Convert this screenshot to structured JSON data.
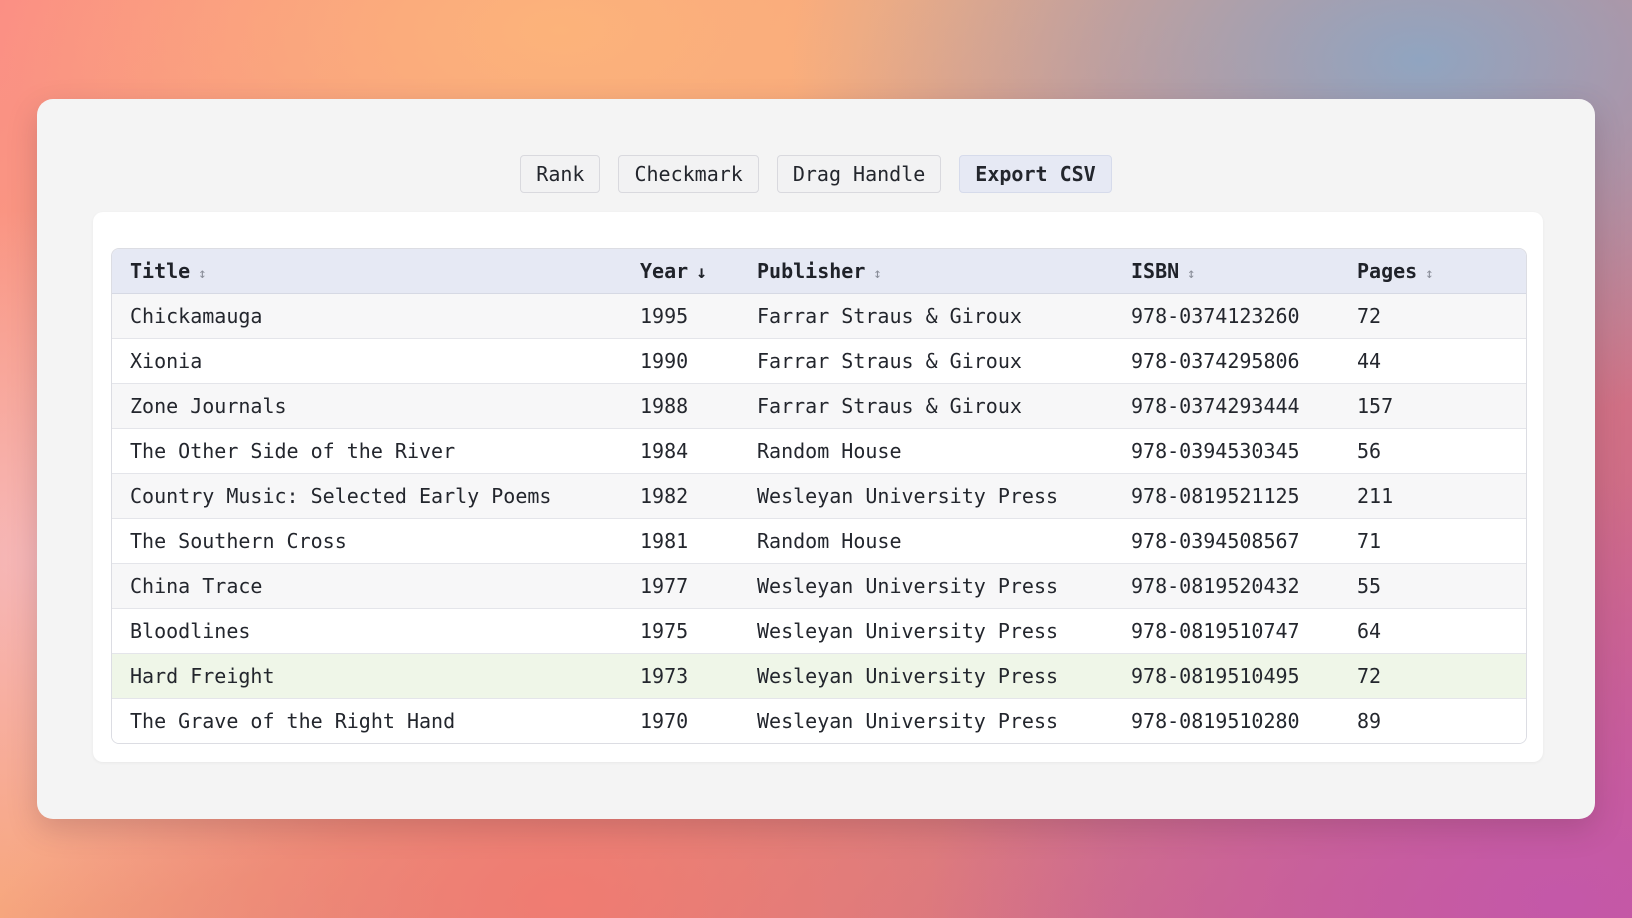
{
  "toolbar": {
    "buttons": [
      {
        "label": "Rank"
      },
      {
        "label": "Checkmark"
      },
      {
        "label": "Drag Handle"
      },
      {
        "label": "Export CSV"
      }
    ]
  },
  "table": {
    "columns": [
      {
        "label": "Title",
        "sort_glyph": "↕"
      },
      {
        "label": "Year",
        "sort_glyph": "↓"
      },
      {
        "label": "Publisher",
        "sort_glyph": "↕"
      },
      {
        "label": "ISBN",
        "sort_glyph": "↕"
      },
      {
        "label": "Pages",
        "sort_glyph": "↕"
      }
    ],
    "sorted_by": "Year",
    "sort_direction": "descending",
    "highlighted_row": 8,
    "rows": [
      {
        "title": "Chickamauga",
        "year": "1995",
        "publisher": "Farrar Straus & Giroux",
        "isbn": "978-0374123260",
        "pages": "72"
      },
      {
        "title": "Xionia",
        "year": "1990",
        "publisher": "Farrar Straus & Giroux",
        "isbn": "978-0374295806",
        "pages": "44"
      },
      {
        "title": "Zone Journals",
        "year": "1988",
        "publisher": "Farrar Straus & Giroux",
        "isbn": "978-0374293444",
        "pages": "157"
      },
      {
        "title": "The Other Side of the River",
        "year": "1984",
        "publisher": "Random House",
        "isbn": "978-0394530345",
        "pages": "56"
      },
      {
        "title": "Country Music: Selected Early Poems",
        "year": "1982",
        "publisher": "Wesleyan University Press",
        "isbn": "978-0819521125",
        "pages": "211"
      },
      {
        "title": "The Southern Cross",
        "year": "1981",
        "publisher": "Random House",
        "isbn": "978-0394508567",
        "pages": "71"
      },
      {
        "title": "China Trace",
        "year": "1977",
        "publisher": "Wesleyan University Press",
        "isbn": "978-0819520432",
        "pages": "55"
      },
      {
        "title": "Bloodlines",
        "year": "1975",
        "publisher": "Wesleyan University Press",
        "isbn": "978-0819510747",
        "pages": "64"
      },
      {
        "title": "Hard Freight",
        "year": "1973",
        "publisher": "Wesleyan University Press",
        "isbn": "978-0819510495",
        "pages": "72"
      },
      {
        "title": "The Grave of the Right Hand",
        "year": "1970",
        "publisher": "Wesleyan University Press",
        "isbn": "978-0819510280",
        "pages": "89"
      }
    ]
  },
  "colors": {
    "header_bg": "#e6e9f4",
    "highlight_row_bg": "#eff6e8",
    "primary_button_bg": "#e6e9f4"
  }
}
